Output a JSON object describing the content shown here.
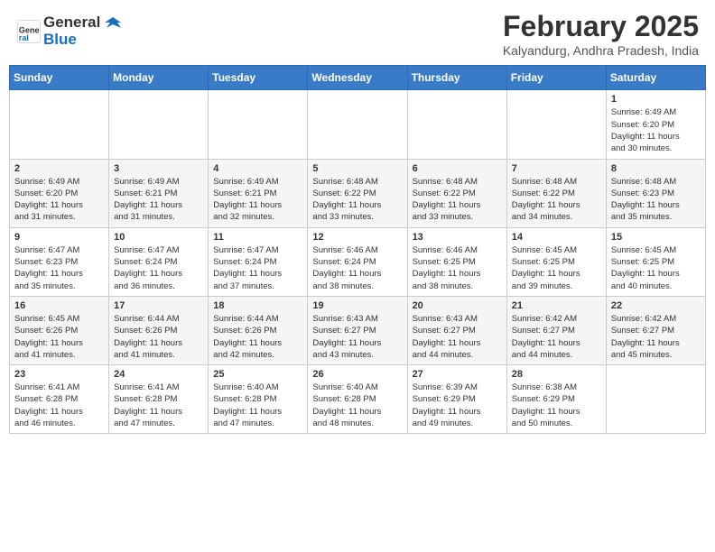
{
  "header": {
    "logo_line1": "General",
    "logo_line2": "Blue",
    "month_title": "February 2025",
    "location": "Kalyandurg, Andhra Pradesh, India"
  },
  "days_of_week": [
    "Sunday",
    "Monday",
    "Tuesday",
    "Wednesday",
    "Thursday",
    "Friday",
    "Saturday"
  ],
  "weeks": [
    [
      {
        "day": "",
        "info": ""
      },
      {
        "day": "",
        "info": ""
      },
      {
        "day": "",
        "info": ""
      },
      {
        "day": "",
        "info": ""
      },
      {
        "day": "",
        "info": ""
      },
      {
        "day": "",
        "info": ""
      },
      {
        "day": "1",
        "info": "Sunrise: 6:49 AM\nSunset: 6:20 PM\nDaylight: 11 hours\nand 30 minutes."
      }
    ],
    [
      {
        "day": "2",
        "info": "Sunrise: 6:49 AM\nSunset: 6:20 PM\nDaylight: 11 hours\nand 31 minutes."
      },
      {
        "day": "3",
        "info": "Sunrise: 6:49 AM\nSunset: 6:21 PM\nDaylight: 11 hours\nand 31 minutes."
      },
      {
        "day": "4",
        "info": "Sunrise: 6:49 AM\nSunset: 6:21 PM\nDaylight: 11 hours\nand 32 minutes."
      },
      {
        "day": "5",
        "info": "Sunrise: 6:48 AM\nSunset: 6:22 PM\nDaylight: 11 hours\nand 33 minutes."
      },
      {
        "day": "6",
        "info": "Sunrise: 6:48 AM\nSunset: 6:22 PM\nDaylight: 11 hours\nand 33 minutes."
      },
      {
        "day": "7",
        "info": "Sunrise: 6:48 AM\nSunset: 6:22 PM\nDaylight: 11 hours\nand 34 minutes."
      },
      {
        "day": "8",
        "info": "Sunrise: 6:48 AM\nSunset: 6:23 PM\nDaylight: 11 hours\nand 35 minutes."
      }
    ],
    [
      {
        "day": "9",
        "info": "Sunrise: 6:47 AM\nSunset: 6:23 PM\nDaylight: 11 hours\nand 35 minutes."
      },
      {
        "day": "10",
        "info": "Sunrise: 6:47 AM\nSunset: 6:24 PM\nDaylight: 11 hours\nand 36 minutes."
      },
      {
        "day": "11",
        "info": "Sunrise: 6:47 AM\nSunset: 6:24 PM\nDaylight: 11 hours\nand 37 minutes."
      },
      {
        "day": "12",
        "info": "Sunrise: 6:46 AM\nSunset: 6:24 PM\nDaylight: 11 hours\nand 38 minutes."
      },
      {
        "day": "13",
        "info": "Sunrise: 6:46 AM\nSunset: 6:25 PM\nDaylight: 11 hours\nand 38 minutes."
      },
      {
        "day": "14",
        "info": "Sunrise: 6:45 AM\nSunset: 6:25 PM\nDaylight: 11 hours\nand 39 minutes."
      },
      {
        "day": "15",
        "info": "Sunrise: 6:45 AM\nSunset: 6:25 PM\nDaylight: 11 hours\nand 40 minutes."
      }
    ],
    [
      {
        "day": "16",
        "info": "Sunrise: 6:45 AM\nSunset: 6:26 PM\nDaylight: 11 hours\nand 41 minutes."
      },
      {
        "day": "17",
        "info": "Sunrise: 6:44 AM\nSunset: 6:26 PM\nDaylight: 11 hours\nand 41 minutes."
      },
      {
        "day": "18",
        "info": "Sunrise: 6:44 AM\nSunset: 6:26 PM\nDaylight: 11 hours\nand 42 minutes."
      },
      {
        "day": "19",
        "info": "Sunrise: 6:43 AM\nSunset: 6:27 PM\nDaylight: 11 hours\nand 43 minutes."
      },
      {
        "day": "20",
        "info": "Sunrise: 6:43 AM\nSunset: 6:27 PM\nDaylight: 11 hours\nand 44 minutes."
      },
      {
        "day": "21",
        "info": "Sunrise: 6:42 AM\nSunset: 6:27 PM\nDaylight: 11 hours\nand 44 minutes."
      },
      {
        "day": "22",
        "info": "Sunrise: 6:42 AM\nSunset: 6:27 PM\nDaylight: 11 hours\nand 45 minutes."
      }
    ],
    [
      {
        "day": "23",
        "info": "Sunrise: 6:41 AM\nSunset: 6:28 PM\nDaylight: 11 hours\nand 46 minutes."
      },
      {
        "day": "24",
        "info": "Sunrise: 6:41 AM\nSunset: 6:28 PM\nDaylight: 11 hours\nand 47 minutes."
      },
      {
        "day": "25",
        "info": "Sunrise: 6:40 AM\nSunset: 6:28 PM\nDaylight: 11 hours\nand 47 minutes."
      },
      {
        "day": "26",
        "info": "Sunrise: 6:40 AM\nSunset: 6:28 PM\nDaylight: 11 hours\nand 48 minutes."
      },
      {
        "day": "27",
        "info": "Sunrise: 6:39 AM\nSunset: 6:29 PM\nDaylight: 11 hours\nand 49 minutes."
      },
      {
        "day": "28",
        "info": "Sunrise: 6:38 AM\nSunset: 6:29 PM\nDaylight: 11 hours\nand 50 minutes."
      },
      {
        "day": "",
        "info": ""
      }
    ]
  ]
}
